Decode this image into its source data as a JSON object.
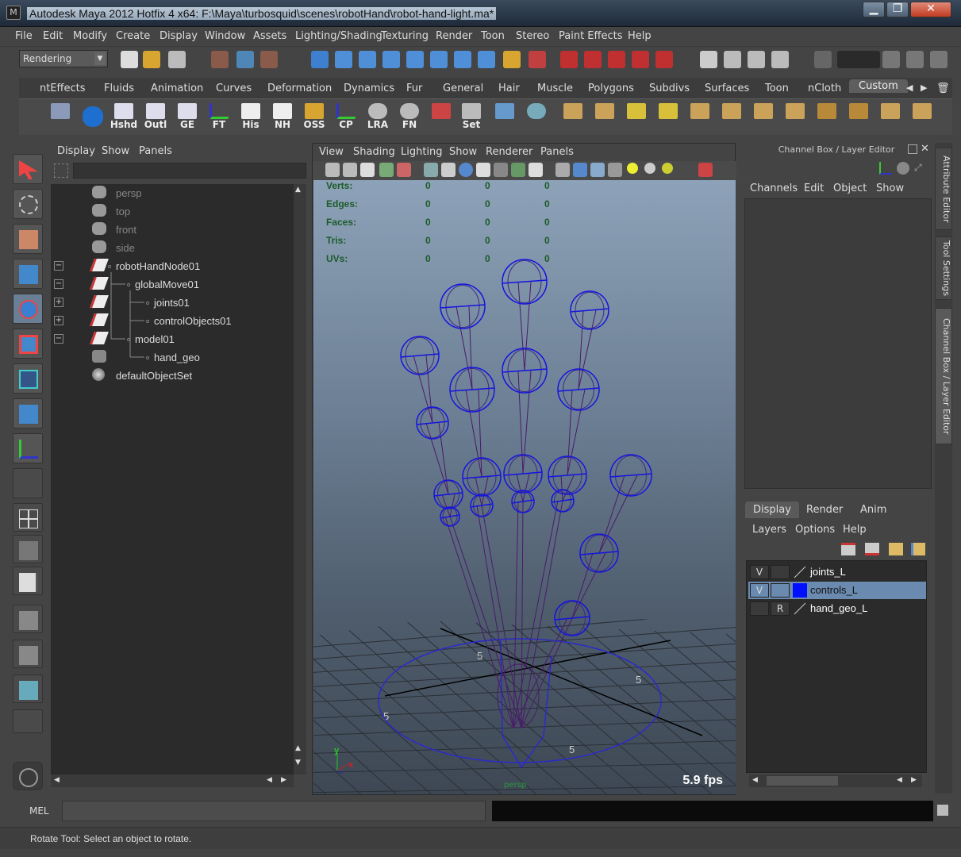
{
  "window": {
    "title": "Autodesk Maya 2012 Hotfix 4 x64: F:\\Maya\\turbosquid\\scenes\\robotHand\\robot-hand-light.ma*",
    "minimize": "▁",
    "maximize": "❐",
    "close": "✕"
  },
  "menubar": [
    "File",
    "Edit",
    "Modify",
    "Create",
    "Display",
    "Window",
    "Assets",
    "Lighting/Shading",
    "Texturing",
    "Render",
    "Toon",
    "Stereo",
    "Paint Effects",
    "Help"
  ],
  "statusline": {
    "mode": "Rendering",
    "mode_arrow": "▼"
  },
  "shelf_tabs": [
    "ntEffects",
    "Fluids",
    "Animation",
    "Curves",
    "Deformation",
    "Dynamics",
    "Fur",
    "General",
    "Hair",
    "Muscle",
    "Polygons",
    "Subdivs",
    "Surfaces",
    "Toon",
    "nCloth",
    "Custom"
  ],
  "shelf_active": "Custom",
  "shelf_buttons": [
    "Hshd",
    "Outl",
    "GE",
    "FT",
    "His",
    "NH",
    "OSS",
    "CP",
    "LRA",
    "FN",
    "Set"
  ],
  "outliner": {
    "menu": [
      "Display",
      "Show",
      "Panels"
    ],
    "items": [
      {
        "label": "persp",
        "dim": true
      },
      {
        "label": "top",
        "dim": true
      },
      {
        "label": "front",
        "dim": true
      },
      {
        "label": "side",
        "dim": true
      },
      {
        "label": "robotHandNode01",
        "dim": false,
        "expander": "−"
      },
      {
        "label": "globalMove01",
        "dim": false,
        "expander": "−"
      },
      {
        "label": "joints01",
        "dim": false,
        "expander": "+"
      },
      {
        "label": "controlObjects01",
        "dim": false,
        "expander": "+"
      },
      {
        "label": "model01",
        "dim": false,
        "expander": "−"
      },
      {
        "label": "hand_geo",
        "dim": false
      },
      {
        "label": "defaultObjectSet",
        "dim": false
      }
    ]
  },
  "viewport": {
    "menu": [
      "View",
      "Shading",
      "Lighting",
      "Show",
      "Renderer",
      "Panels"
    ],
    "hud": [
      {
        "label": "Verts:",
        "values": [
          "0",
          "0",
          "0"
        ]
      },
      {
        "label": "Edges:",
        "values": [
          "0",
          "0",
          "0"
        ]
      },
      {
        "label": "Faces:",
        "values": [
          "0",
          "0",
          "0"
        ]
      },
      {
        "label": "Tris:",
        "values": [
          "0",
          "0",
          "0"
        ]
      },
      {
        "label": "UVs:",
        "values": [
          "0",
          "0",
          "0"
        ]
      }
    ],
    "grid_label": "5",
    "fps": "5.9 fps",
    "camera": "persp",
    "axis_y": "y",
    "axis_x": "x"
  },
  "channel_box": {
    "title": "Channel Box / Layer Editor",
    "menu": [
      "Channels",
      "Edit",
      "Object",
      "Show"
    ]
  },
  "side_tabs": [
    "Attribute Editor",
    "Tool Settings",
    "Channel Box / Layer Editor"
  ],
  "layer_editor": {
    "tabs": [
      "Display",
      "Render",
      "Anim"
    ],
    "active_tab": "Display",
    "menu": [
      "Layers",
      "Options",
      "Help"
    ],
    "layers": [
      {
        "v": "V",
        "r": "",
        "name": "joints_L",
        "color": "",
        "selected": false
      },
      {
        "v": "V",
        "r": "",
        "name": "controls_L",
        "color": "#0010ff",
        "selected": true
      },
      {
        "v": "",
        "r": "R",
        "name": "hand_geo_L",
        "color": "",
        "selected": false
      }
    ]
  },
  "cmdline": {
    "label": "MEL"
  },
  "helpline": {
    "text": "Rotate Tool: Select an object to rotate."
  }
}
